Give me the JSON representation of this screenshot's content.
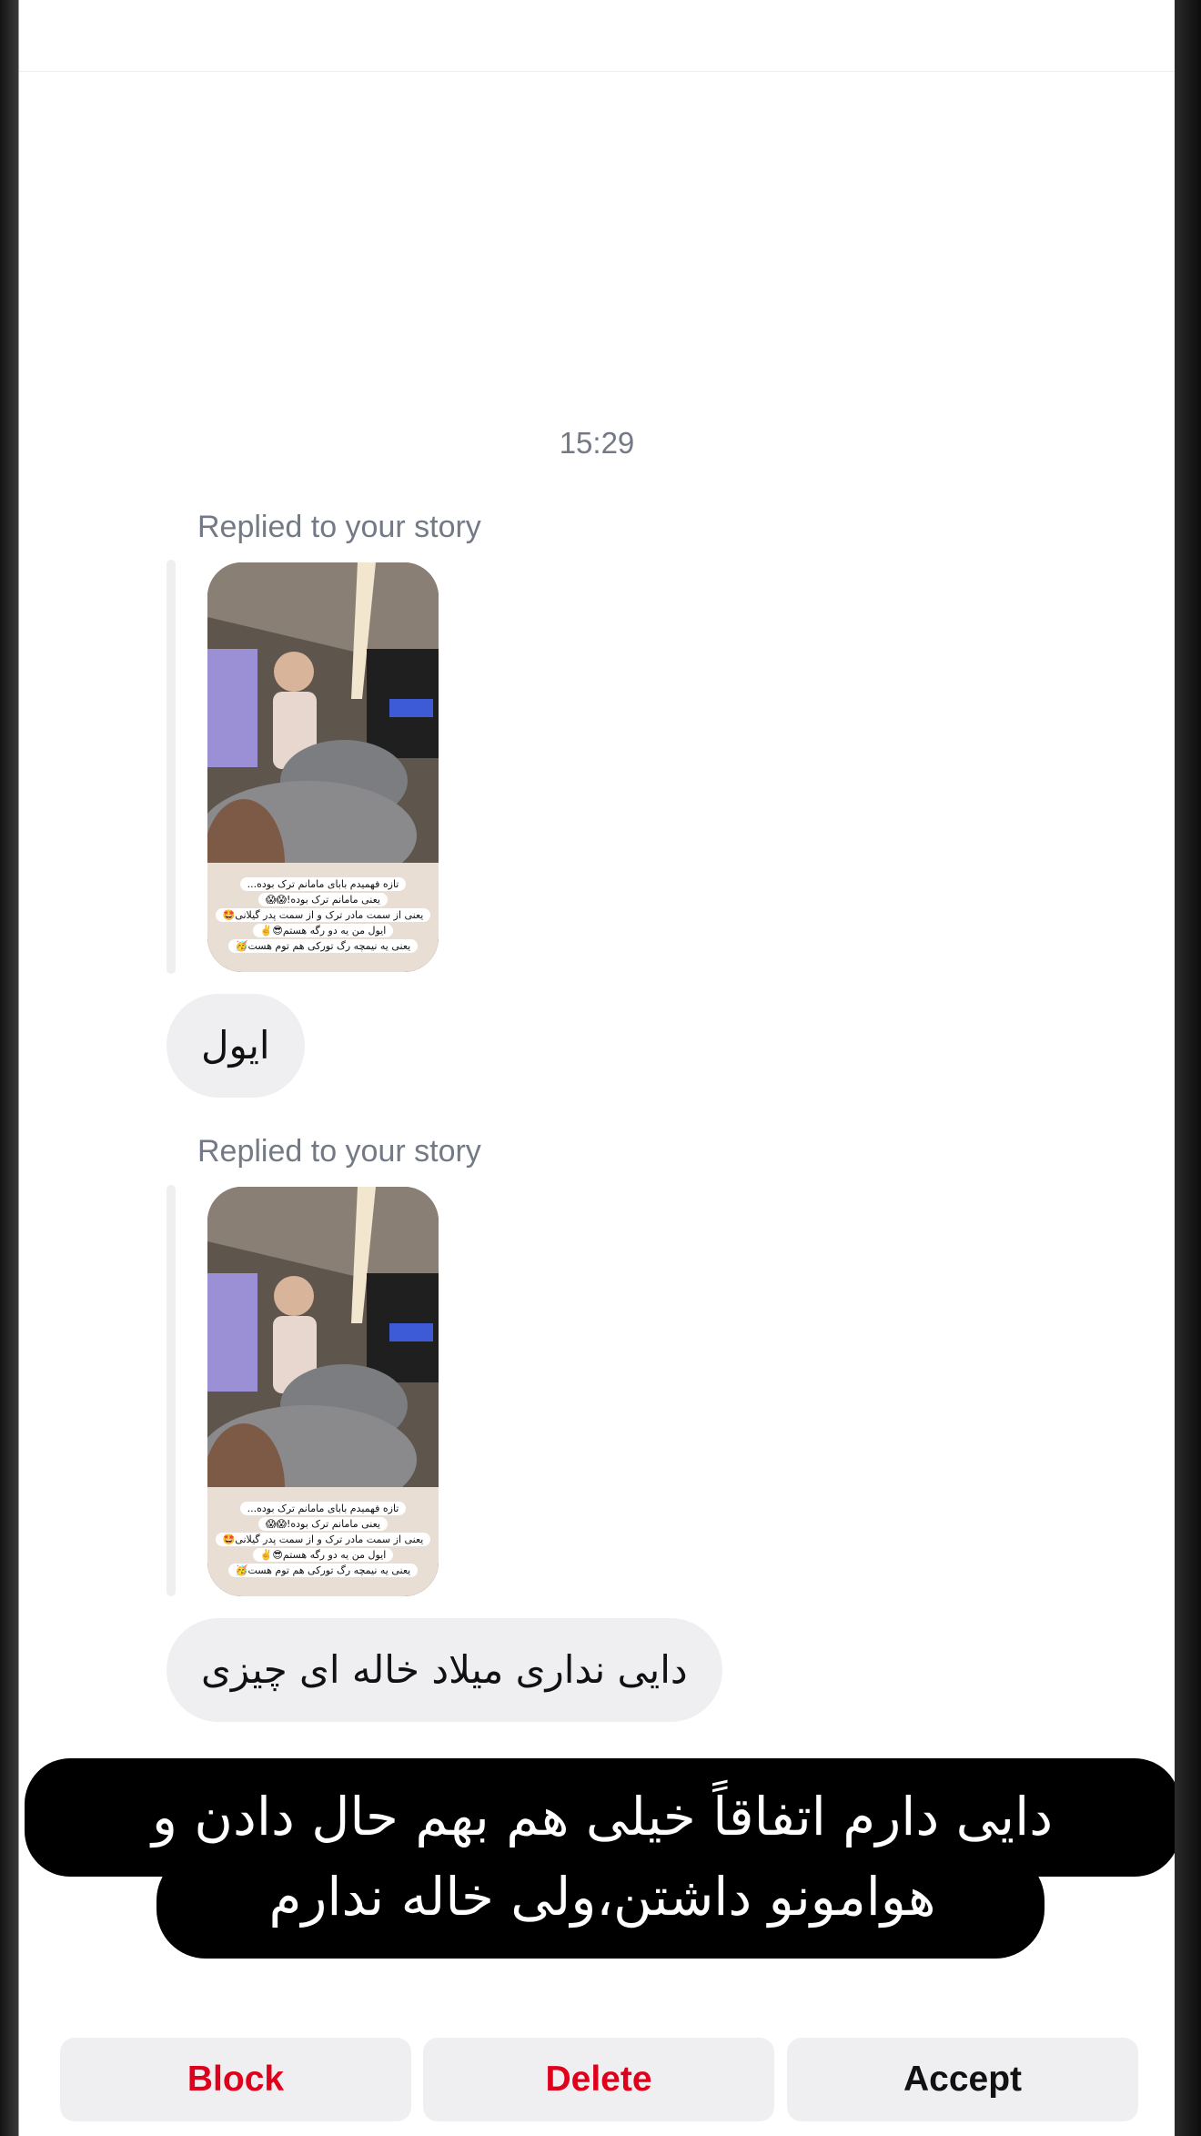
{
  "conversation": {
    "timestamp": "15:29",
    "messages": [
      {
        "reply_label": "Replied to your story",
        "story_caption_lines": [
          "تازه فهمیدم بابای مامانم ترک بوده...",
          "یعنی مامانم ترک بوده!😱😱",
          "یعنی از سمت مادر ترک و از سمت پدر گیلانی🤩",
          "ایول من یه دو رگه هستم😎✌️",
          "یعنی یه نیمچه رگ تورکی هم توم هست🥳"
        ],
        "text": "ایول"
      },
      {
        "reply_label": "Replied to your story",
        "story_caption_lines": [
          "تازه فهمیدم بابای مامانم ترک بوده...",
          "یعنی مامانم ترک بوده!😱😱",
          "یعنی از سمت مادر ترک و از سمت پدر گیلانی🤩",
          "ایول من یه دو رگه هستم😎✌️",
          "یعنی یه نیمچه رگ تورکی هم توم هست🥳"
        ],
        "text": "دایی نداری میلاد خاله ای چیزی"
      }
    ]
  },
  "overlay_caption": {
    "line1": "دایی دارم اتفاقاً خیلی هم بهم حال دادن و",
    "line2": "هوامونو داشتن،ولی خاله ندارم"
  },
  "actions": {
    "block_label": "Block",
    "delete_label": "Delete",
    "accept_label": "Accept"
  },
  "colors": {
    "danger": "#e0001b",
    "bubble_bg": "#efeff1",
    "muted_text": "#737a86"
  }
}
